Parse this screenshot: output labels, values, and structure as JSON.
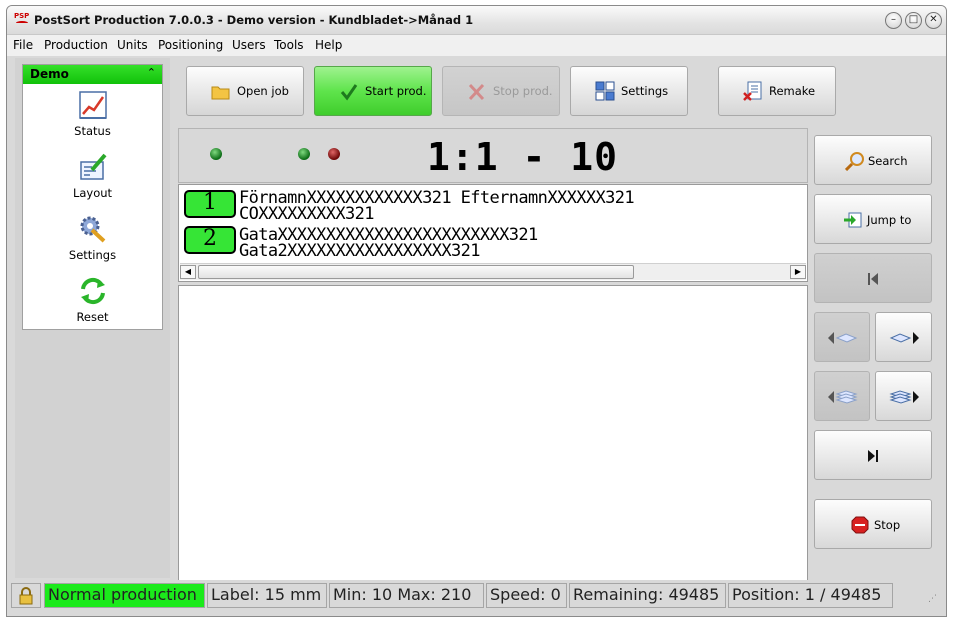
{
  "window": {
    "title": "PostSort Production 7.0.0.3  -  Demo version  -  Kundbladet->Månad 1",
    "app_icon_text": "PSP",
    "controls": [
      "minimize",
      "maximize",
      "close"
    ]
  },
  "menu": [
    "File",
    "Production",
    "Units",
    "Positioning",
    "Users",
    "Tools",
    "Help"
  ],
  "nav": {
    "header": "Demo",
    "items": [
      {
        "label": "Status",
        "icon": "chart-icon"
      },
      {
        "label": "Layout",
        "icon": "layout-pen-icon"
      },
      {
        "label": "Settings",
        "icon": "gear-wrench-icon"
      },
      {
        "label": "Reset",
        "icon": "refresh-icon"
      }
    ]
  },
  "toolbar": {
    "open_job": "Open job",
    "start_prod": "Start prod.",
    "stop_prod": "Stop prod.",
    "settings": "Settings",
    "remake": "Remake"
  },
  "display": {
    "position_text": "1:1 - 10",
    "leds": [
      "green",
      "green",
      "red"
    ]
  },
  "label_preview": {
    "lines": [
      {
        "number": "1",
        "text1": "FörnamnXXXXXXXXXXXX321 EfternamnXXXXXX321",
        "text2": "COXXXXXXXXX321"
      },
      {
        "number": "2",
        "text1": "GataXXXXXXXXXXXXXXXXXXXXXXXX321",
        "text2": "Gata2XXXXXXXXXXXXXXXXX321"
      }
    ]
  },
  "side_buttons": {
    "search": "Search",
    "jump_to": "Jump to",
    "stop": "Stop"
  },
  "status": {
    "mode": "Normal production",
    "label": "Label: 15 mm",
    "minmax": "Min: 10  Max: 210",
    "speed": "Speed: 0",
    "remaining": "Remaining: 49485",
    "position": "Position: 1 / 49485"
  },
  "colors": {
    "green_accent": "#1bea1b",
    "nav_header": "#11c10a",
    "background": "#d9d9d9"
  }
}
